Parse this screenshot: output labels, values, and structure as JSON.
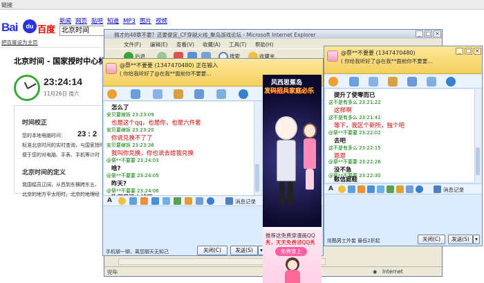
{
  "browser_bg": {
    "topbar_label": "链接",
    "logo": {
      "bai": "Bai",
      "du": "du",
      "cn": "百度"
    },
    "nav": [
      "新闻",
      "网页",
      "贴吧",
      "知道",
      "MP3",
      "图片",
      "视频"
    ],
    "search_value": "北京时间",
    "set_home": "把百度设为主页",
    "result_title": "北京时间 - 国家授时中心标准时间",
    "clock_time": "23:24:14",
    "clock_date": "11月26日  周六",
    "sec1_title": "时间校正",
    "sec1_line1": "您的本地电脑时间：",
    "sec1_big": "23 : 2",
    "sec1_line2": "标准北京时间的实时查询，与国家授时",
    "sec1_line3": "便于您的对电脑、手表、手机等计时",
    "sec2_title": "北京时间的定义",
    "sec2_line1": "我国幅员辽阔，从西到东横跨东五、",
    "sec2_line2": "北京的地方平太阳时。北京的地理经"
  },
  "ie_window": {
    "title": "搁才的48章不要？还要便宜_CF穿越火线_聚岛游戏论坛 - Microsoft Internet Explorer",
    "menu": [
      "文件(F)",
      "编辑(E)",
      "查看(V)",
      "收藏(A)",
      "工具(T)",
      "帮助(H)"
    ],
    "back_label": "后退",
    "search_label": "搜索",
    "favorites_label": "收藏夹",
    "status_text": "完毕",
    "status_zone": "Internet"
  },
  "chat1": {
    "user": "@祭**不要要 (1347470480)  正在输入",
    "signature": "( 你给我听好了@在我**面前你不要要...",
    "messages": [
      {
        "kind": "text",
        "style": "blk",
        "text": "怎么了"
      },
      {
        "kind": "meta",
        "text": "安贝要嫁妖   23:23:09"
      },
      {
        "kind": "text",
        "style": "red",
        "text": "也是这个qq，也是你，也是六件套"
      },
      {
        "kind": "meta",
        "text": "安贝要嫁妖   23:23:20"
      },
      {
        "kind": "text",
        "style": "red",
        "text": "你说兑换不了了"
      },
      {
        "kind": "meta",
        "text": "安贝要嫁妖   23:23:38"
      },
      {
        "kind": "text",
        "style": "red",
        "text": "我叫你兑换，你也说去给我兑换"
      },
      {
        "kind": "meta",
        "text": "@祭**不要要   23:24:03"
      },
      {
        "kind": "text",
        "style": "blk",
        "text": "啥?"
      },
      {
        "kind": "meta",
        "text": "@祭**不要要   23:24:05"
      },
      {
        "kind": "text",
        "style": "blk",
        "text": "昨天?"
      },
      {
        "kind": "meta",
        "text": "@祭**不要要   23:24:06"
      },
      {
        "kind": "text",
        "style": "blk",
        "text": "昨天我没上线可"
      }
    ],
    "history_label": "消息记录",
    "footer_note": "手机聊一聊，离您聊天无知己",
    "close_label": "关闭(C)",
    "send_label": "发送(S)",
    "game_title1": "风西思蕉岛",
    "game_title2": "发码招兵家庭必乐",
    "ad_line1": "推荐这免费穿漫画QQ",
    "ad_line2": "秀，天天免费领QQ秀",
    "ad_button": "免费穿上"
  },
  "chat2": {
    "user": "@祭**不要要 (1347470480)",
    "signature": "( 你给我听好了@在我**面前你不要要...",
    "messages": [
      {
        "kind": "text",
        "style": "blk",
        "text": "提升了使零而已"
      },
      {
        "kind": "meta",
        "text": "这不是有多么   23:21:22"
      },
      {
        "kind": "text",
        "style": "red",
        "text": "这样啊"
      },
      {
        "kind": "meta",
        "text": "这不是有多么   23:21:41"
      },
      {
        "kind": "text",
        "style": "red",
        "text": "等下，我区个新所，独个吧"
      },
      {
        "kind": "meta",
        "text": "@祭**不要要   23:22:02"
      },
      {
        "kind": "text",
        "style": "blk",
        "text": "去吧"
      },
      {
        "kind": "meta",
        "text": "这不是有多么   23:22:15"
      },
      {
        "kind": "text",
        "style": "red",
        "text": "恩恩"
      },
      {
        "kind": "meta",
        "text": "@祭**不要要   23:22:26"
      },
      {
        "kind": "text",
        "style": "blk",
        "text": "没不急"
      },
      {
        "kind": "meta",
        "text": "@祭**不要要   23:22:30"
      },
      {
        "kind": "text",
        "style": "blk",
        "text": "慰信庭鞋"
      }
    ],
    "history_label": "消息记录",
    "footer_note": "炫酷男士外套 最低2折起",
    "close_label": "关闭(C)",
    "send_label": "发送(S)"
  },
  "colors": {
    "chat_header": "#f3cf5e",
    "chat_bg": "#dcecff",
    "message_red": "#d40000",
    "meta_green": "#007a00",
    "baidu_blue": "#2932e1",
    "baidu_red": "#e10602"
  }
}
